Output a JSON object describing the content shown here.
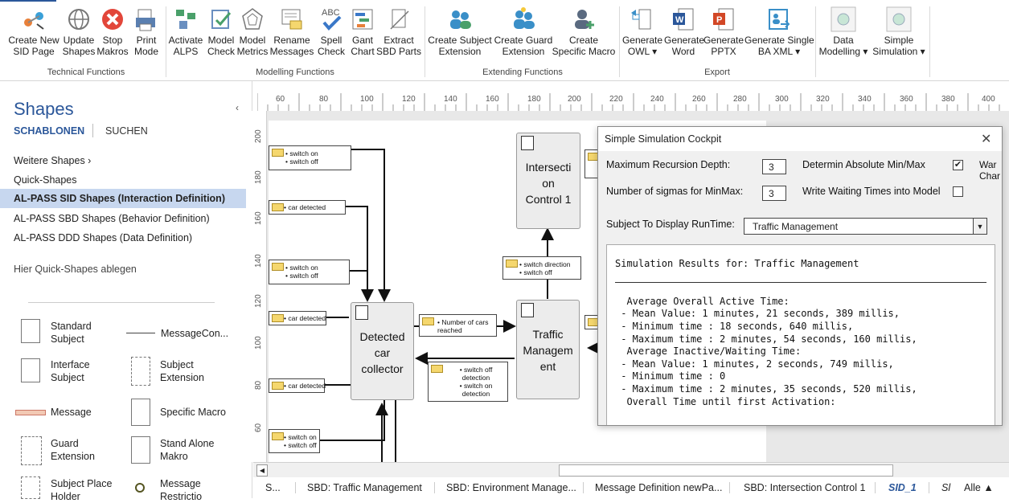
{
  "ribbon": {
    "groups": [
      {
        "label": "Technical Functions"
      },
      {
        "label": "Modelling Functions"
      },
      {
        "label": "Extending Functions"
      },
      {
        "label": "Export"
      }
    ],
    "buttons": [
      {
        "label": "Create New\nSID Page",
        "icon": "sid-page-icon"
      },
      {
        "label": "Update\nShapes",
        "icon": "globe-icon"
      },
      {
        "label": "Stop\nMakros",
        "icon": "stop-icon"
      },
      {
        "label": "Print\nMode",
        "icon": "print-icon"
      },
      {
        "label": "Activate\nALPS",
        "icon": "alps-icon"
      },
      {
        "label": "Model\nCheck",
        "icon": "model-check-icon"
      },
      {
        "label": "Model\nMetrics",
        "icon": "metrics-icon"
      },
      {
        "label": "Rename\nMessages",
        "icon": "rename-icon"
      },
      {
        "label": "Spell\nCheck",
        "icon": "spell-check-icon"
      },
      {
        "label": "Gant\nChart",
        "icon": "gant-chart-icon"
      },
      {
        "label": "Extract\nSBD Parts",
        "icon": "extract-icon"
      },
      {
        "label": "Create Subject\nExtension",
        "icon": "subject-extension-icon"
      },
      {
        "label": "Create Guard\nExtension",
        "icon": "guard-extension-icon"
      },
      {
        "label": "Create\nSpecific Macro",
        "icon": "macro-icon"
      },
      {
        "label": "Generate\nOWL ▾",
        "icon": "owl-icon"
      },
      {
        "label": "Generate\nWord",
        "icon": "word-icon"
      },
      {
        "label": "Generate\nPPTX",
        "icon": "pptx-icon"
      },
      {
        "label": "Generate Single\nBA XML ▾",
        "icon": "xml-icon"
      },
      {
        "label": "Data\nModelling ▾",
        "icon": "data-modelling-icon"
      },
      {
        "label": "Simple\nSimulation ▾",
        "icon": "simulation-icon"
      }
    ]
  },
  "shapes_panel": {
    "title": "Shapes",
    "collapse": "‹",
    "tabs": [
      "SCHABLONEN",
      "SUCHEN"
    ],
    "stencils": [
      "Weitere Shapes  ›",
      "Quick-Shapes",
      "AL-PASS SID Shapes (Interaction Definition)",
      "AL-PASS SBD Shapes (Behavior Definition)",
      "AL-PASS DDD Shapes (Data Definition)"
    ],
    "selected_stencil": 2,
    "drop_hint": "Hier Quick-Shapes ablegen",
    "shapes": [
      {
        "label": "Standard\nSubject"
      },
      {
        "label": "MessageCon..."
      },
      {
        "label": "Interface\nSubject"
      },
      {
        "label": "Subject\nExtension"
      },
      {
        "label": "Message"
      },
      {
        "label": "Specific Macro"
      },
      {
        "label": "Guard\nExtension"
      },
      {
        "label": "Stand Alone\nMakro"
      },
      {
        "label": "Subject Place\nHolder"
      },
      {
        "label": "Message\nRestrictio"
      }
    ]
  },
  "ruler": {
    "top": [
      "60",
      "80",
      "100",
      "120",
      "140",
      "160",
      "180",
      "200",
      "220",
      "240",
      "260",
      "280",
      "300",
      "320",
      "340",
      "360",
      "380",
      "400"
    ],
    "left": [
      "200",
      "180",
      "160",
      "140",
      "120",
      "100",
      "80",
      "60"
    ]
  },
  "diagram": {
    "subjects": [
      {
        "name": "Detected\ncar\ncollector"
      },
      {
        "name": "Intersecti\non\nControl 1"
      },
      {
        "name": "Traffic\nManagem\nent"
      }
    ],
    "messages": [
      {
        "text": "• switch on\n• switch off"
      },
      {
        "text": "• car detected"
      },
      {
        "text": "• switch on\n• switch off"
      },
      {
        "text": "• car detected"
      },
      {
        "text": "• car detected"
      },
      {
        "text": "• switch on\n• switch off"
      },
      {
        "text": "• Number of cars\nreached"
      },
      {
        "text": "• switch direction\n• switch off"
      },
      {
        "text": "• switch off\ndetection\n• switch on\ndetection"
      }
    ]
  },
  "simulation": {
    "title": "Simple Simulation Cockpit",
    "close": "✕",
    "recursion_label": "Maximum Recursion Depth:",
    "recursion_value": "3",
    "sigmas_label": "Number of sigmas for MinMax:",
    "sigmas_value": "3",
    "minmax_label": "Determin Absolute Min/Max",
    "minmax_checked": "✔",
    "waiting_label": "Write Waiting Times into Model",
    "cut_label": "War\nChar",
    "subject_label": "Subject To Display RunTime:",
    "subject_value": "Traffic Management",
    "select_arrow": "▼",
    "results": "Simulation Results for: Traffic Management\n\n\n  Average Overall Active Time:\n - Mean Value: 1 minutes, 21 seconds, 389 millis,\n - Minimum time : 18 seconds, 640 millis,\n - Maximum time : 2 minutes, 54 seconds, 160 millis,\n  Average Inactive/Waiting Time:\n - Mean Value: 1 minutes, 2 seconds, 749 millis,\n - Minimum time : 0\n - Maximum time : 2 minutes, 35 seconds, 520 millis,\n  Overall Time until first Activation:"
  },
  "scroll": {
    "left_arrow": "◀"
  },
  "page_tabs": [
    {
      "label": "S..."
    },
    {
      "label": "SBD: Traffic Management"
    },
    {
      "label": "SBD: Environment Manage..."
    },
    {
      "label": "Message Definition newPa..."
    },
    {
      "label": "SBD: Intersection Control 1"
    },
    {
      "label": "SID_1"
    },
    {
      "label": "Sl"
    },
    {
      "label": "Alle ▲"
    }
  ],
  "active_tab": 5,
  "colors": {
    "accent": "#2b579a",
    "selected": "#c7d7ef",
    "envelope": "#f5d76e"
  }
}
